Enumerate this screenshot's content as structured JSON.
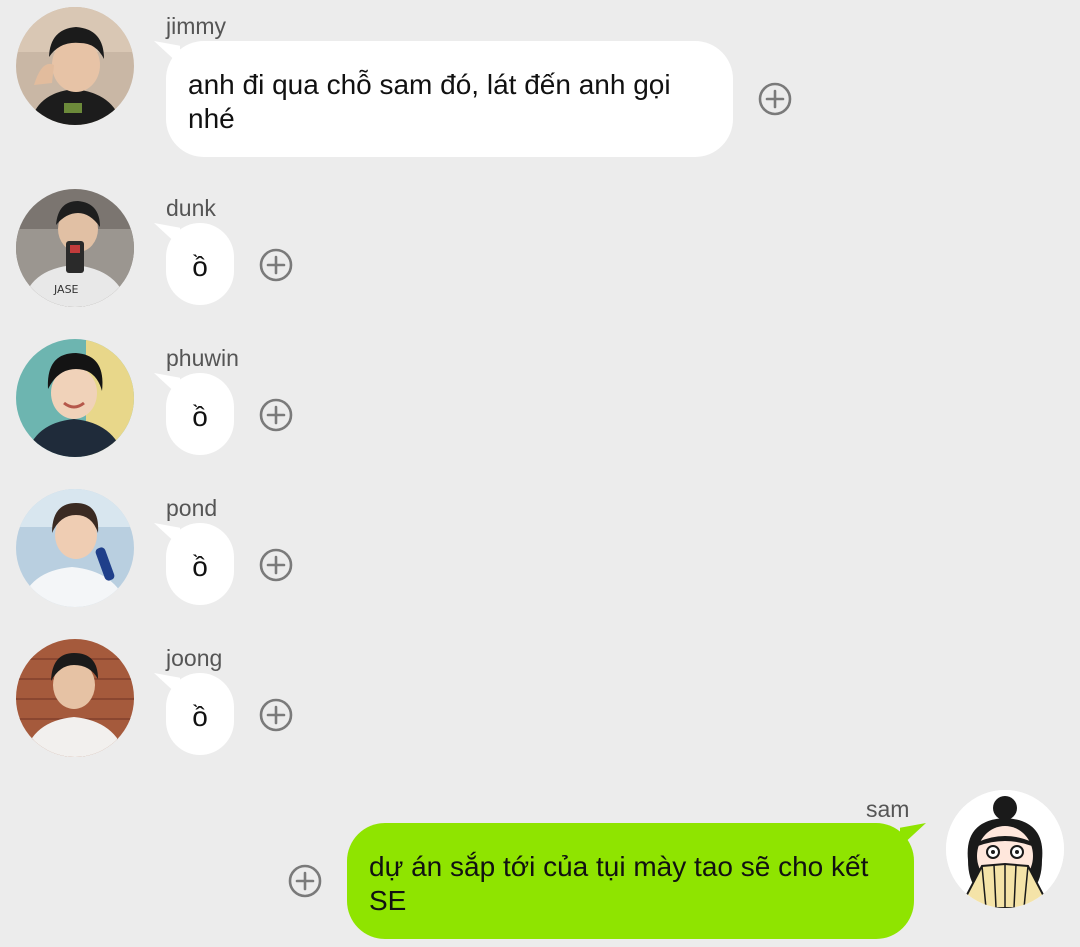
{
  "messages": [
    {
      "sender": "jimmy",
      "text": "anh đi qua chỗ sam đó, lát đến anh gọi nhé",
      "avatar_icon": "jimmy-avatar",
      "action_icon": "add-reaction-icon"
    },
    {
      "sender": "dunk",
      "text": "ồ",
      "avatar_icon": "dunk-avatar",
      "action_icon": "add-reaction-icon"
    },
    {
      "sender": "phuwin",
      "text": "ồ",
      "avatar_icon": "phuwin-avatar",
      "action_icon": "add-reaction-icon"
    },
    {
      "sender": "pond",
      "text": "ồ",
      "avatar_icon": "pond-avatar",
      "action_icon": "add-reaction-icon"
    },
    {
      "sender": "joong",
      "text": "ồ",
      "avatar_icon": "joong-avatar",
      "action_icon": "add-reaction-icon"
    },
    {
      "sender": "sam",
      "text": "dự án sắp tới của tụi mày tao sẽ cho kết SE",
      "avatar_icon": "sam-avatar",
      "action_icon": "add-reaction-icon",
      "outgoing": true
    }
  ],
  "colors": {
    "background": "#ececec",
    "incoming_bubble": "#ffffff",
    "outgoing_bubble": "#8fe400",
    "sender_name": "#555555",
    "icon_gray": "#7a7a7a"
  }
}
